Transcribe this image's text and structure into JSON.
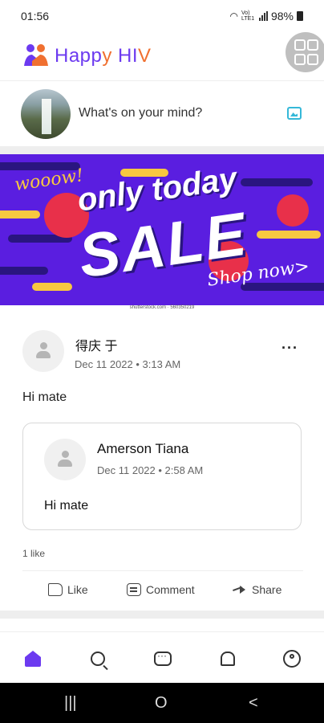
{
  "status_bar": {
    "time": "01:56",
    "battery": "98%",
    "network": "Vo) LTE1"
  },
  "header": {
    "app_title_part1": "Happ",
    "app_title_y": "y",
    "app_title_hiv": "HI",
    "app_title_v": "V",
    "colors": {
      "primary": "#6c3af0",
      "orange": "#f07030",
      "menu_bg": "#bfbfbf"
    }
  },
  "composer": {
    "placeholder": "What's on your mind?"
  },
  "banner": {
    "wooow": "wooow!",
    "only_today": "only today",
    "sale": "SALE",
    "shop_now": "Shop now>",
    "credit": "shutterstock.com · 560350219"
  },
  "post": {
    "author": "得庆 于",
    "meta": "Dec 11 2022 • 3:13 AM",
    "more": "···",
    "text": "Hi mate",
    "shared": {
      "author": "Amerson Tiana",
      "meta": "Dec 11 2022 • 2:58 AM",
      "text": "Hi mate"
    },
    "likes": "1 like",
    "actions": {
      "like": "Like",
      "comment": "Comment",
      "share": "Share"
    }
  },
  "bottom_nav": {
    "items": [
      {
        "icon": "home-icon",
        "active": true
      },
      {
        "icon": "search-icon",
        "active": false
      },
      {
        "icon": "chat-icon",
        "active": false
      },
      {
        "icon": "bell-icon",
        "active": false
      },
      {
        "icon": "profile-icon",
        "active": false
      }
    ]
  },
  "system_nav": {
    "recents": "|||",
    "home": "O",
    "back": "<"
  }
}
